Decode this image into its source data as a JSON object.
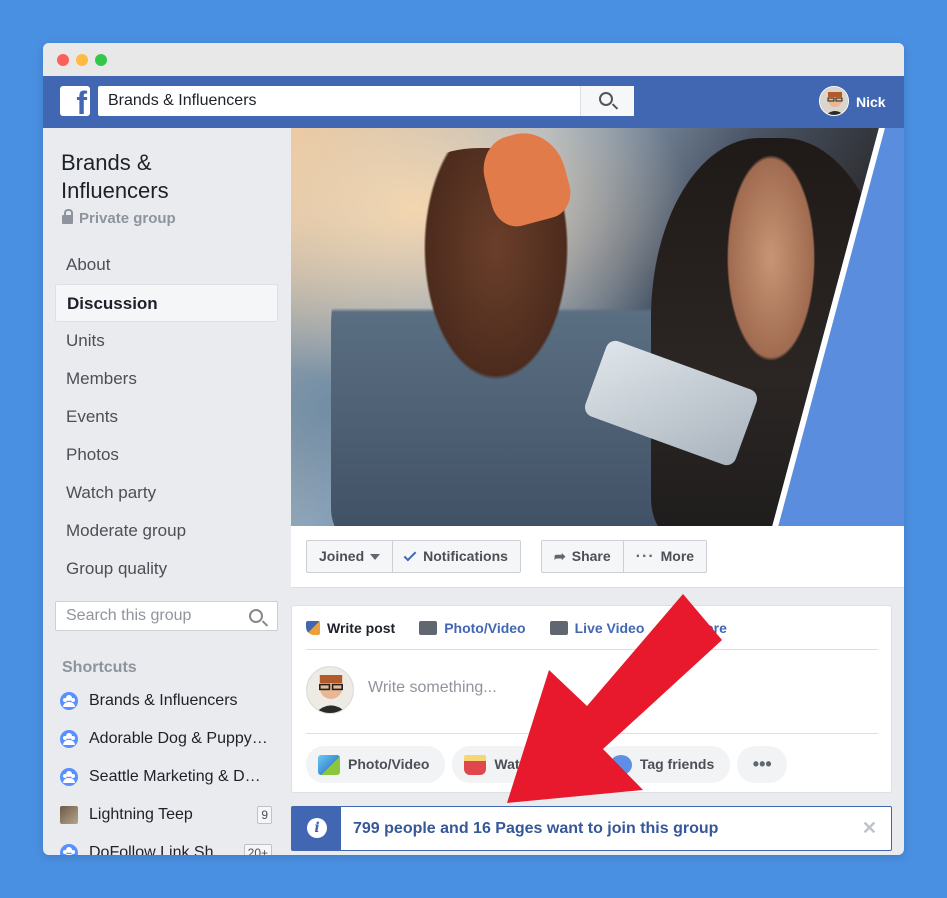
{
  "topbar": {
    "logo": "f",
    "search_value": "Brands & Influencers",
    "user_name": "Nick"
  },
  "sidebar": {
    "group_title": "Brands & Influencers",
    "privacy": "Private group",
    "nav": [
      {
        "label": "About"
      },
      {
        "label": "Discussion",
        "active": true
      },
      {
        "label": "Units"
      },
      {
        "label": "Members"
      },
      {
        "label": "Events"
      },
      {
        "label": "Photos"
      },
      {
        "label": "Watch party"
      },
      {
        "label": "Moderate group"
      },
      {
        "label": "Group quality"
      }
    ],
    "search_placeholder": "Search this group",
    "shortcuts_title": "Shortcuts",
    "shortcuts": [
      {
        "label": "Brands & Influencers",
        "icon": "group-icon"
      },
      {
        "label": "Adorable Dog & Puppy Videos",
        "icon": "group-icon"
      },
      {
        "label": "Seattle Marketing & Design",
        "icon": "group-icon"
      },
      {
        "label": "Lightning Teep",
        "icon": "photo-icon",
        "badge": "9"
      },
      {
        "label": "DoFollow Link Sharing",
        "icon": "group-icon",
        "badge": "20+"
      }
    ]
  },
  "actions": {
    "joined": "Joined",
    "notifications": "Notifications",
    "share": "Share",
    "more": "More"
  },
  "composer": {
    "tabs": [
      "Write post",
      "Photo/Video",
      "Live Video",
      "More"
    ],
    "placeholder": "Write something...",
    "pills": [
      "Photo/Video",
      "Watch Party",
      "Tag friends"
    ]
  },
  "notice": {
    "text": "799 people and 16 Pages want to join this group"
  },
  "colors": {
    "fb_blue": "#4267b2",
    "background": "#4a90e2",
    "arrow_red": "#e8192c"
  }
}
